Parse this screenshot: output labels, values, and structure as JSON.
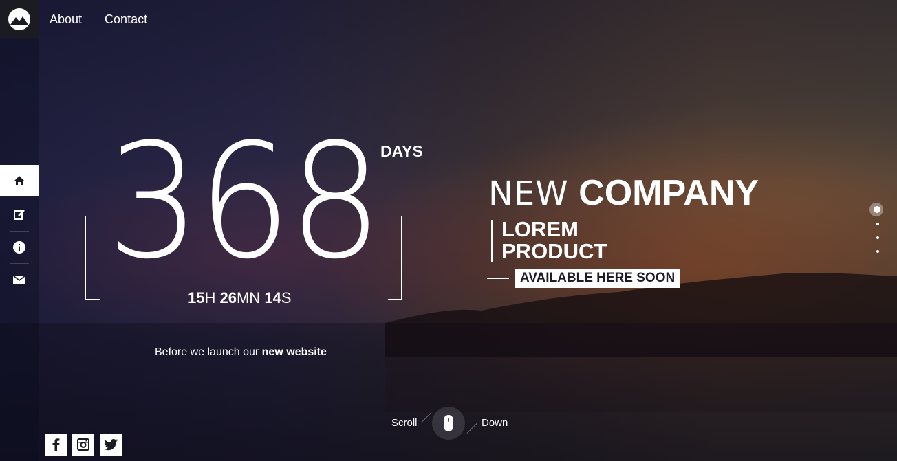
{
  "nav": {
    "about": "About",
    "contact": "Contact"
  },
  "countdown": {
    "days": "368",
    "days_label": "DAYS",
    "hours": "15",
    "hours_unit": "H",
    "minutes": "26",
    "minutes_unit": "MN",
    "seconds": "14",
    "seconds_unit": "S"
  },
  "tagline": {
    "prefix": "Before we launch our",
    "emphasis": "new website"
  },
  "headline": {
    "thin": "NEW",
    "bold": "COMPANY",
    "product_line1": "LOREM",
    "product_line2": "PRODUCT",
    "badge": "AVAILABLE HERE SOON"
  },
  "scroll": {
    "left": "Scroll",
    "right": "Down"
  },
  "sidebar": {
    "icons": [
      "home-icon",
      "edit-icon",
      "info-icon",
      "mail-icon"
    ]
  },
  "social": [
    "facebook-icon",
    "instagram-icon",
    "twitter-icon"
  ],
  "slides": {
    "count": 4,
    "active": 1
  }
}
